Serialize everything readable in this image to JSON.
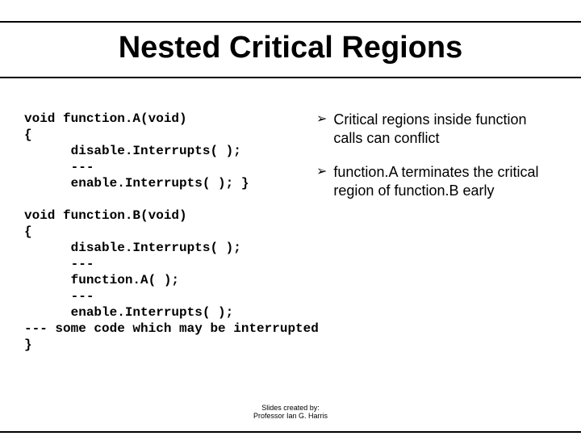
{
  "title": "Nested Critical Regions",
  "code": {
    "l1": "void function.A(void)",
    "l2": "{",
    "l3": "      disable.Interrupts( );",
    "l4": "      ---",
    "l5": "      enable.Interrupts( ); }",
    "l6": "",
    "l7": "void function.B(void)",
    "l8": "{",
    "l9": "      disable.Interrupts( );",
    "l10": "      ---",
    "l11": "      function.A( );",
    "l12": "      ---",
    "l13": "      enable.Interrupts( );",
    "l14": "--- some code which may be interrupted",
    "l15": "}"
  },
  "bullets": [
    {
      "marker": "➢",
      "text": "Critical regions inside function calls can conflict"
    },
    {
      "marker": "➢",
      "text": "function.A terminates the critical region of function.B early"
    }
  ],
  "credit": {
    "line1": "Slides created by:",
    "line2": "Professor Ian G. Harris"
  }
}
